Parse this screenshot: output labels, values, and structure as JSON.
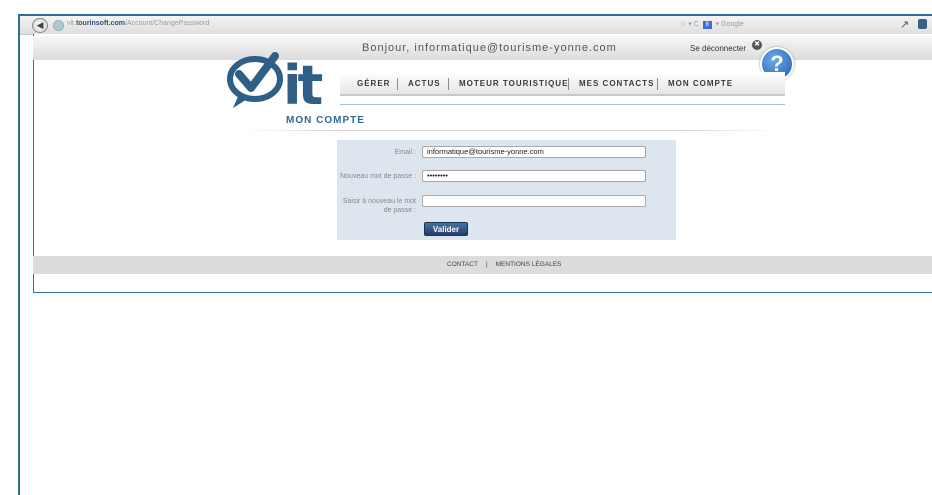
{
  "browser": {
    "url_prefix": "vit.",
    "url_domain": "tourinsoft.com",
    "url_path": "/Account/ChangePassword",
    "search_engine": "Google",
    "reload_glyph": "C"
  },
  "header": {
    "greeting": "Bonjour, informatique@tourisme-yonne.com",
    "logout_label": "Se déconnecter",
    "help_label": "?"
  },
  "logo": {
    "text": "it"
  },
  "nav": {
    "items": [
      {
        "label": "GÉRER"
      },
      {
        "label": "ACTUS"
      },
      {
        "label": "MOTEUR TOURISTIQUE"
      },
      {
        "label": "MES CONTACTS"
      },
      {
        "label": "MON COMPTE"
      }
    ]
  },
  "page": {
    "title": "MON COMPTE"
  },
  "form": {
    "email_label": "Email :",
    "email_value": "informatique@tourisme-yonne.com",
    "new_password_label": "Nouveau mot de passe :",
    "new_password_value": "••••••••",
    "confirm_password_label_line1": "Saisir à nouveau le mot",
    "confirm_password_label_line2": "de passe :",
    "confirm_password_value": "",
    "submit_label": "Valider"
  },
  "footer": {
    "contact_label": "CONTACT",
    "separator": "|",
    "legal_label": "MENTIONS LÉGALES"
  },
  "colors": {
    "frame": "#2b6ea0",
    "logo_blue": "#2f5f86",
    "title_blue": "#2e6a9e",
    "form_bg": "#dde6ef",
    "button": "#2f4f7f"
  }
}
